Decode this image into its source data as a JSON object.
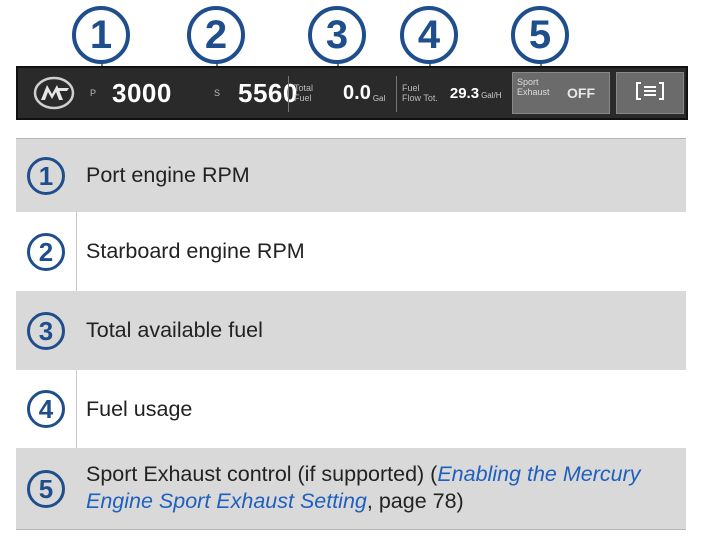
{
  "callouts": [
    "1",
    "2",
    "3",
    "4",
    "5"
  ],
  "engine_bar": {
    "port_label": "P",
    "port_rpm": "3000",
    "starboard_label": "S",
    "starboard_rpm": "5560",
    "total_fuel_label_1": "Total",
    "total_fuel_label_2": "Fuel",
    "total_fuel_value": "0.0",
    "total_fuel_unit": "Gal",
    "fuel_flow_label_1": "Fuel",
    "fuel_flow_label_2": "Flow Tot.",
    "fuel_flow_value": "29.3",
    "fuel_flow_unit": "Gal/H",
    "sport_label_1": "Sport",
    "sport_label_2": "Exhaust",
    "sport_state": "OFF",
    "logo_icon": "mercury-logo-icon",
    "menu_icon": "menu-icon"
  },
  "legend": [
    {
      "num": "1",
      "text": "Port engine RPM"
    },
    {
      "num": "2",
      "text": "Starboard engine RPM"
    },
    {
      "num": "3",
      "text": "Total available fuel"
    },
    {
      "num": "4",
      "text": "Fuel usage"
    },
    {
      "num": "5",
      "text_before": "Sport Exhaust control (if supported) (",
      "link": "Enabling the Mercury Engine Sport Exhaust Setting",
      "text_after": ", page 78)"
    }
  ],
  "colors": {
    "callout_blue": "#1f4e8c",
    "link_blue": "#1f5fbf",
    "row_gray": "#d9d9d9",
    "bar_dark": "#2a2a2a"
  }
}
